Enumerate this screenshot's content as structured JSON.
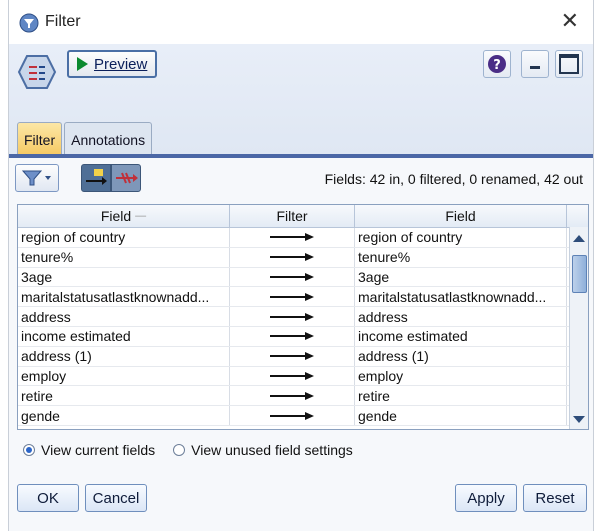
{
  "window": {
    "title": "Filter",
    "close_glyph": "✕"
  },
  "toolbar": {
    "preview_label": "Preview",
    "help_glyph": "?"
  },
  "tabs": [
    {
      "label": "Filter",
      "active": true
    },
    {
      "label": "Annotations",
      "active": false
    }
  ],
  "filter_panel": {
    "summary": "Fields: 42 in, 0 filtered, 0 renamed, 42 out",
    "columns": [
      "Field",
      "Filter",
      "Field"
    ],
    "rows": [
      {
        "in": "region of country",
        "out": "region of country"
      },
      {
        "in": "tenure%",
        "out": "tenure%"
      },
      {
        "in": "3age",
        "out": "3age"
      },
      {
        "in": "maritalstatusatlastknownadd...",
        "out": "maritalstatusatlastknownadd..."
      },
      {
        "in": "address",
        "out": "address"
      },
      {
        "in": "income estimated",
        "out": "income estimated"
      },
      {
        "in": "address (1)",
        "out": "address (1)"
      },
      {
        "in": "employ",
        "out": "employ"
      },
      {
        "in": "retire",
        "out": "retire"
      },
      {
        "in": "gende",
        "out": "gende"
      }
    ],
    "view_options": {
      "current": "View current fields",
      "unused": "View unused field settings",
      "selected": "current"
    }
  },
  "buttons": {
    "ok": "OK",
    "cancel": "Cancel",
    "apply": "Apply",
    "reset": "Reset"
  },
  "colors": {
    "tab_active": "#f5c861",
    "tab_underline": "#4b67a6",
    "accent": "#2c66c9"
  }
}
